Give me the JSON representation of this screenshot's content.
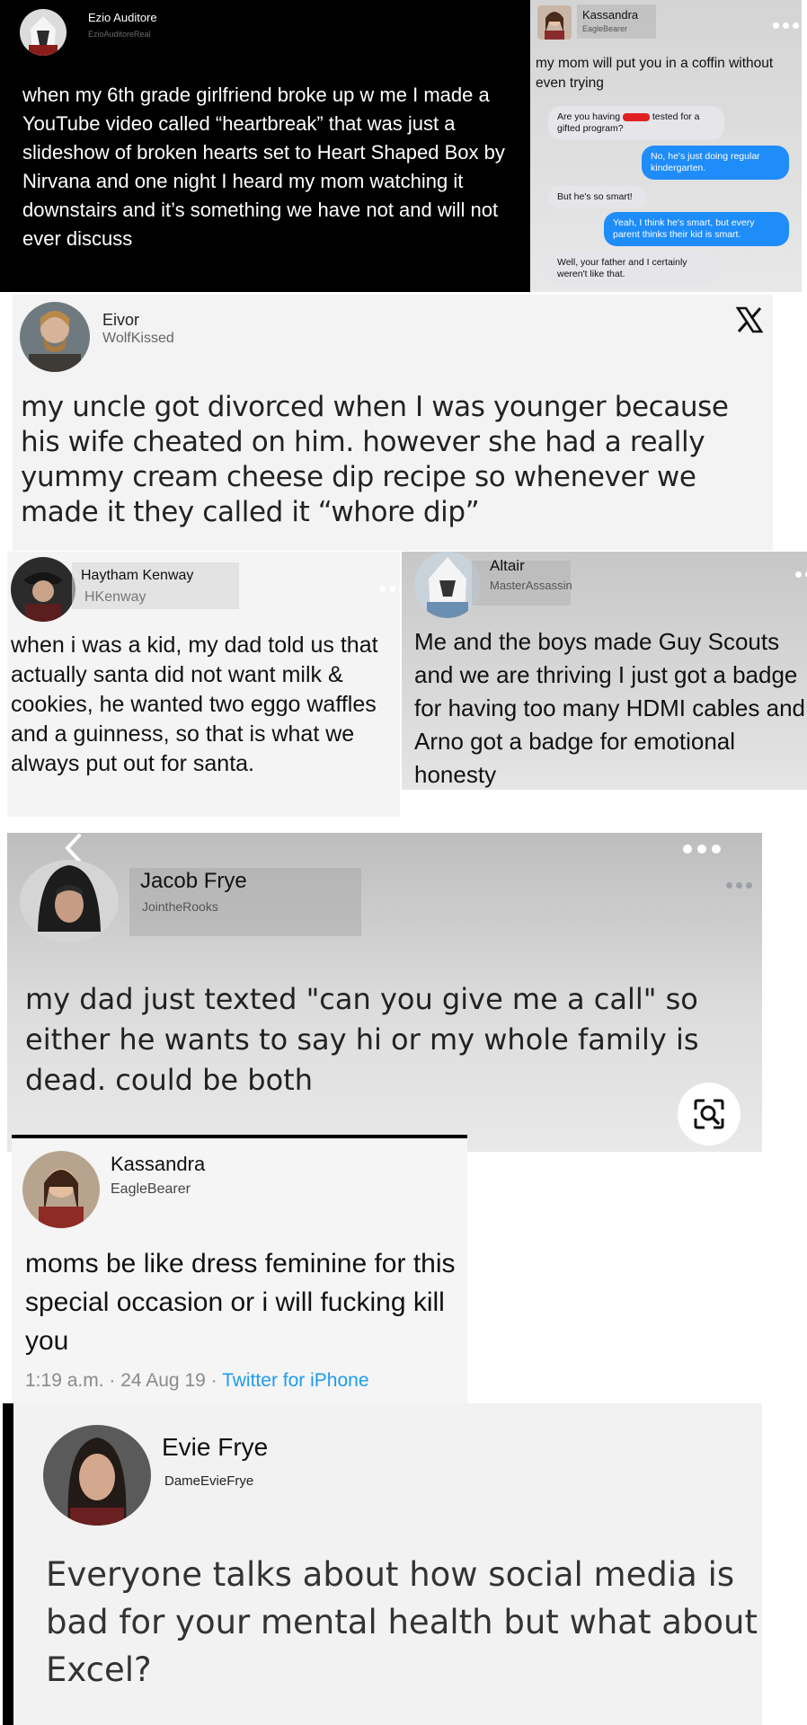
{
  "posts": [
    {
      "name": "Ezio Auditore",
      "handle": "EzioAuditoreReal",
      "text": "when my 6th grade girlfriend broke up w me I made a YouTube video called “heartbreak” that was just a slideshow of broken hearts set to Heart Shaped Box by Nirvana and one night I heard my mom watching it downstairs and it’s something we have not and will not ever discuss"
    },
    {
      "name": "Kassandra",
      "handle": "EagleBearer",
      "text": "my mom will put you in a coffin without even trying",
      "messages": [
        {
          "dir": "in",
          "text_before": "Are you having ",
          "text_after": " tested for a gifted program?"
        },
        {
          "dir": "out",
          "text": "No, he's just doing regular kindergarten."
        },
        {
          "dir": "in",
          "text": "But he's so smart!"
        },
        {
          "dir": "out",
          "text": "Yeah, I think he's smart, but every parent thinks their kid is smart."
        },
        {
          "dir": "in",
          "text": "Well, your father and I certainly weren't like that."
        }
      ]
    },
    {
      "name": "Eivor",
      "handle": "WolfKissed",
      "text": "my uncle got divorced when I was younger because his wife cheated on him. however she had a really yummy cream cheese dip recipe so whenever we made it they called it “whore dip”",
      "logo": "x-logo"
    },
    {
      "name": "Haytham Kenway",
      "handle": "HKenway",
      "text": "when i was a kid, my dad told us that actually santa did not want milk & cookies, he wanted two eggo waffles and a guinness, so that is what we always put out for santa."
    },
    {
      "name": "Altair",
      "handle": "MasterAssassin",
      "text": "Me and the boys made Guy Scouts and we are thriving I just got a badge for having too many HDMI cables and Arno  got a badge for emotional honesty"
    },
    {
      "name": "Jacob Frye",
      "handle": "JointheRooks",
      "text": "my dad just texted \"can you give me a call\" so either he wants to say hi or my whole family is dead. could be both"
    },
    {
      "name": "Kassandra",
      "handle": "EagleBearer",
      "text": "moms be like dress feminine for this special occasion or i will fucking kill you",
      "meta_time": "1:19 a.m. · 24 Aug 19 · ",
      "meta_source": "Twitter for iPhone"
    },
    {
      "name": "Evie Frye",
      "handle": "DameEvieFrye",
      "text": "Everyone talks about how social media is bad for your mental health but what about Excel?"
    }
  ],
  "colors": {
    "imessage_blue": "#1e8cf9",
    "twitter_blue": "#1d9bf0",
    "redaction": "#e02020"
  }
}
